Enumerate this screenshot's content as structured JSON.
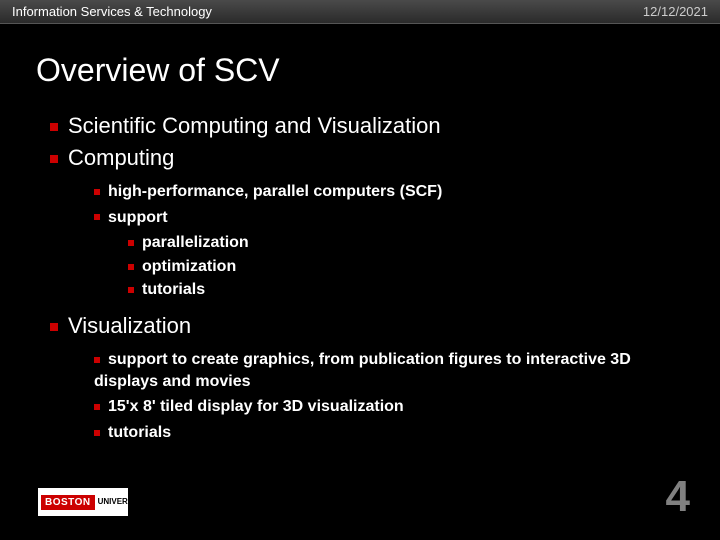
{
  "header": {
    "left": "Information Services & Technology",
    "right": "12/12/2021"
  },
  "title": "Overview of SCV",
  "bullets": {
    "b1": "Scientific Computing and Visualization",
    "b2": "Computing",
    "b2_1": "high-performance, parallel computers (SCF)",
    "b2_2": "support",
    "b2_2_1": "parallelization",
    "b2_2_2": "optimization",
    "b2_2_3": "tutorials",
    "b3": "Visualization",
    "b3_1": "support to create graphics, from publication figures to interactive 3D displays and movies",
    "b3_2": "15'x 8' tiled display for 3D visualization",
    "b3_3": "tutorials"
  },
  "logo": {
    "main": "BOSTON",
    "sub": "UNIVERSITY"
  },
  "page_number": "4"
}
